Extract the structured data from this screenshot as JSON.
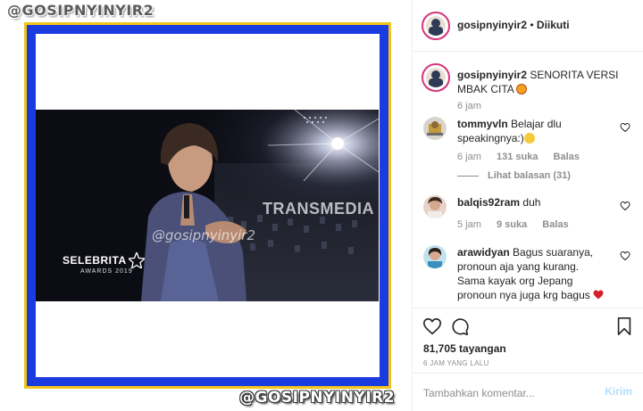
{
  "media": {
    "watermark_top": "@GOSIPNYINYIR2",
    "watermark_bottom": "@GOSIPNYINYIR2",
    "video_overlay": {
      "channel": "TRANSMEDIA",
      "watermark": "@gosipnyinyir2",
      "show_title": "SELEBRITA",
      "show_sub": "AWARDS 2019"
    },
    "colors": {
      "frame_outer": "#f2c418",
      "frame_inner": "#1a3be0"
    }
  },
  "header": {
    "username": "gosipnyinyir2",
    "separator": "•",
    "follow_status": "Diikuti"
  },
  "caption": {
    "username": "gosipnyinyir2",
    "text": "SENORITA VERSI MBAK CITA",
    "emoji": "star-struck-emoji",
    "time": "6 jam"
  },
  "comments": [
    {
      "username": "tommyvln",
      "text": "Belajar dlu speakingnya:)",
      "emoji": "crying-emoji",
      "time": "6 jam",
      "likes": "131 suka",
      "reply_label": "Balas",
      "view_replies": "Lihat balasan (31)"
    },
    {
      "username": "balqis92ram",
      "text": "duh",
      "time": "5 jam",
      "likes": "9 suka",
      "reply_label": "Balas"
    },
    {
      "username": "arawidyan",
      "text": "Bagus suaranya, pronoun aja yang kurang. Sama kayak org Jepang pronoun nya juga krg bagus",
      "emoji": "red-heart-emoji"
    }
  ],
  "actions": {
    "views": "81,705 tayangan",
    "posted": "6 JAM YANG LALU"
  },
  "add_comment": {
    "placeholder": "Tambahkan komentar...",
    "submit_label": "Kirim"
  }
}
